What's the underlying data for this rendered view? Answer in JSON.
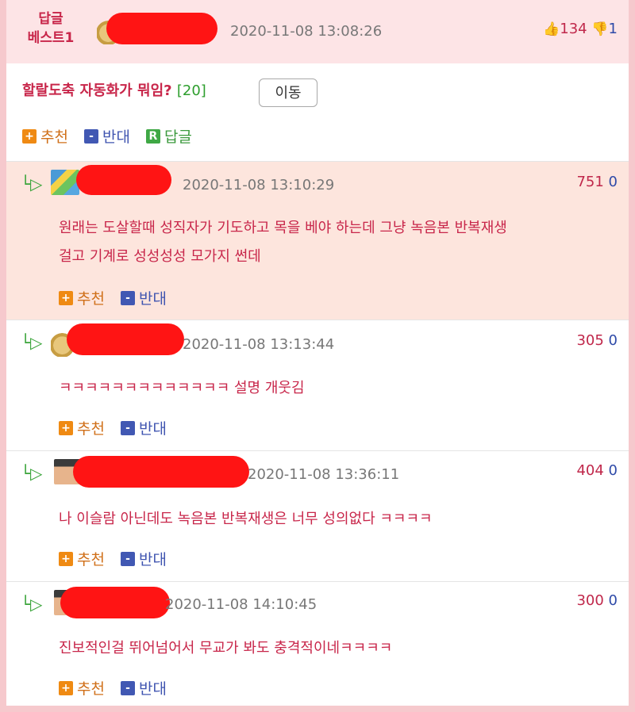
{
  "best": {
    "label_line1": "답글",
    "label_line2": "베스트1",
    "time": "2020-11-08 13:08:26",
    "up": "134",
    "down": "1"
  },
  "post": {
    "title": "할랄도축 자동화가 뭐임?",
    "count": "[20]",
    "move_label": "이동"
  },
  "actions": {
    "recommend": "추천",
    "oppose": "반대",
    "reply": "답글",
    "plus": "+",
    "minus": "-",
    "r": "R"
  },
  "comments": [
    {
      "time": "2020-11-08 13:10:29",
      "up": "751",
      "down": "0",
      "text1": "원래는 도살할때 성직자가 기도하고 목을 베야 하는데 그냥 녹음본 반복재생",
      "text2": "걸고 기계로 성성성성 모가지 썬데"
    },
    {
      "time": "2020-11-08 13:13:44",
      "up": "305",
      "down": "0",
      "text1": "ㅋㅋㅋㅋㅋㅋㅋㅋㅋㅋㅋㅋㅋ 설명 개웃김"
    },
    {
      "time": "2020-11-08 13:36:11",
      "up": "404",
      "down": "0",
      "text1": "나 이슬람 아닌데도 녹음본 반복재생은 너무 성의없다 ㅋㅋㅋㅋ"
    },
    {
      "time": "2020-11-08 14:10:45",
      "up": "300",
      "down": "0",
      "text1": "진보적인걸 뛰어넘어서 무교가 봐도 충격적이네ㅋㅋㅋㅋ"
    }
  ],
  "colors": {
    "accent": "#c8264a",
    "up": "#c0284b",
    "down": "#2e4aa8",
    "recommend": "#ef8a13",
    "oppose": "#4158b3",
    "reply": "#3fa845"
  }
}
